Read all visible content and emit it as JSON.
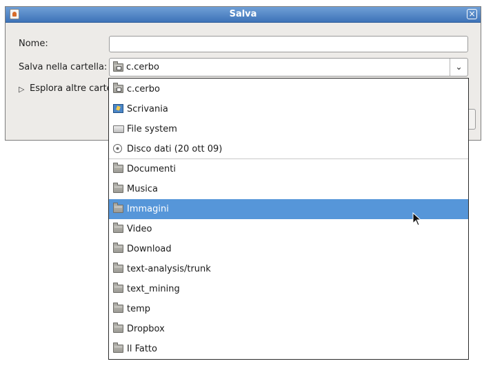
{
  "window": {
    "title": "Salva",
    "close_glyph": "×"
  },
  "form": {
    "name_label": "Nome:",
    "name_value": "",
    "folder_label": "Salva nella cartella:",
    "folder_value": "c.cerbo",
    "browse_label": "Esplora altre carte"
  },
  "dropdown": {
    "items": [
      {
        "label": "c.cerbo",
        "icon": "home-folder-icon"
      },
      {
        "label": "Scrivania",
        "icon": "desktop-icon"
      },
      {
        "label": "File system",
        "icon": "drive-icon"
      },
      {
        "label": "Disco dati (20 ott 09)",
        "icon": "disc-icon"
      },
      {
        "label": "Documenti",
        "icon": "folder-icon"
      },
      {
        "label": "Musica",
        "icon": "folder-icon"
      },
      {
        "label": "Immagini",
        "icon": "folder-icon",
        "selected": true
      },
      {
        "label": "Video",
        "icon": "folder-icon"
      },
      {
        "label": "Download",
        "icon": "folder-icon"
      },
      {
        "label": "text-analysis/trunk",
        "icon": "folder-icon"
      },
      {
        "label": "text_mining",
        "icon": "folder-icon"
      },
      {
        "label": "temp",
        "icon": "folder-icon"
      },
      {
        "label": "Dropbox",
        "icon": "folder-icon"
      },
      {
        "label": "Il Fatto",
        "icon": "folder-icon"
      }
    ]
  },
  "colors": {
    "titlebar": "#3e73b8",
    "selection": "#5696d9",
    "window_bg": "#edebe8"
  }
}
